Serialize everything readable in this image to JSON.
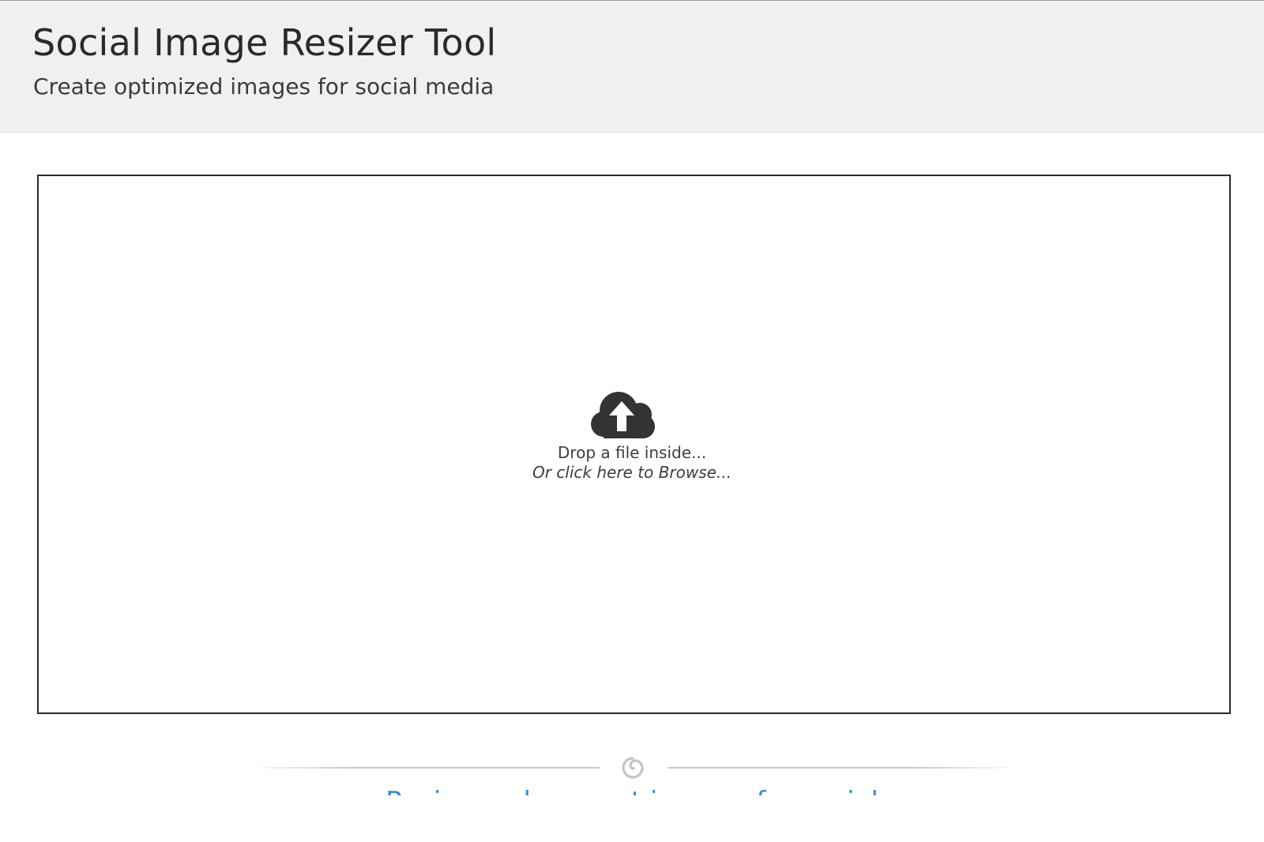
{
  "header": {
    "title": "Social Image Resizer Tool",
    "subtitle": "Create optimized images for social media"
  },
  "dropzone": {
    "icon": "cloud-upload-icon",
    "primary_text": "Drop a file inside...",
    "secondary_text": "Or click here to Browse..."
  },
  "divider": {
    "icon": "swirl-ornament-icon"
  },
  "teaser": {
    "text": "Resize and convert images for social"
  },
  "colors": {
    "header_bg": "#f0f0ef",
    "title_text": "#2a2a2a",
    "icon": "#333333",
    "link_blue": "#3b8fc6",
    "divider": "#c8c8c8"
  }
}
